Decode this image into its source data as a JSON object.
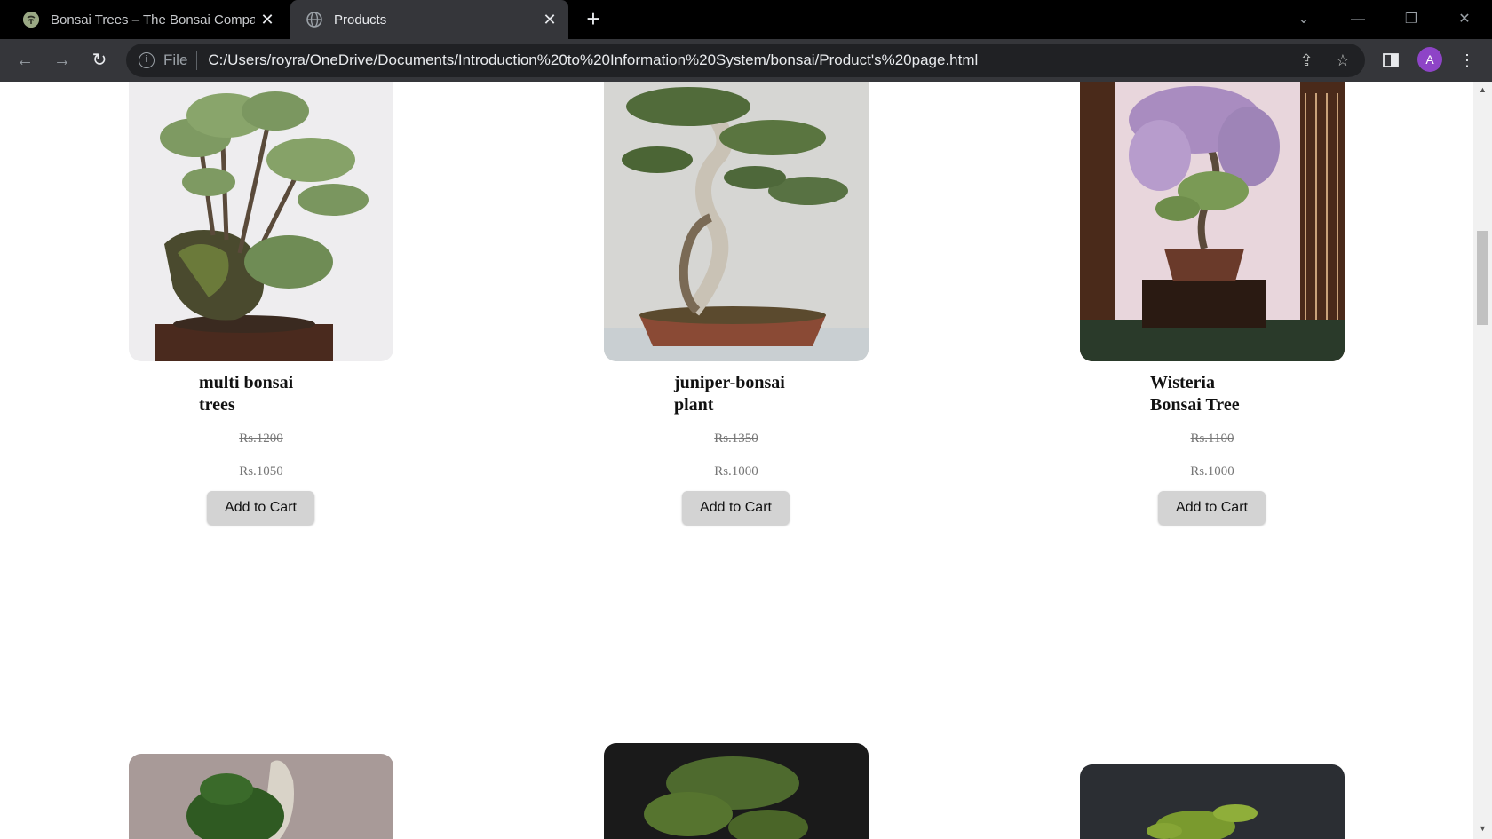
{
  "browser": {
    "tabs": [
      {
        "title": "Bonsai Trees – The Bonsai Compa",
        "active": false
      },
      {
        "title": "Products",
        "active": true
      }
    ],
    "address": {
      "scheme": "File",
      "url": "C:/Users/royra/OneDrive/Documents/Introduction%20to%20Information%20System/bonsai/Product's%20page.html"
    },
    "profile_initial": "A"
  },
  "products": [
    {
      "name_line1": "multi bonsai",
      "name_line2": "trees",
      "old_price": "Rs.1200",
      "price": "Rs.1050",
      "button": "Add to Cart"
    },
    {
      "name_line1": "juniper-bonsai",
      "name_line2": "plant",
      "old_price": "Rs.1350",
      "price": "Rs.1000",
      "button": "Add to Cart"
    },
    {
      "name_line1": "Wisteria",
      "name_line2": "Bonsai Tree",
      "old_price": "Rs.1100",
      "price": "Rs.1000",
      "button": "Add to Cart"
    }
  ],
  "colors": {
    "chrome_bg": "#000000",
    "toolbar_bg": "#35363a",
    "button_bg": "#d3d3d3",
    "price_text": "#777777"
  }
}
